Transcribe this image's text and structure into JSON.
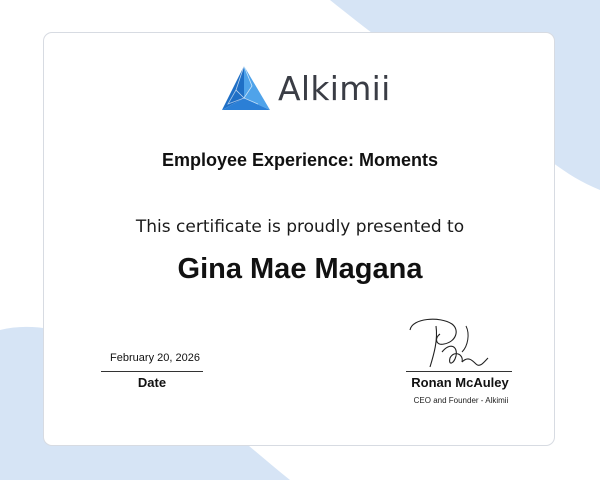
{
  "certificate": {
    "logo_text": "Alkimii",
    "course_title": "Employee Experience: Moments",
    "presented_text": "This certificate is proudly presented to",
    "recipient_name": "Gina Mae Magana",
    "date_value": "February 20, 2026",
    "date_label": "Date",
    "signer_name": "Ronan McAuley",
    "signer_title": "CEO and Founder - Alkimii"
  },
  "colors": {
    "background_wave": "#d6e4f5",
    "logo_blue_dark": "#1f6fc6",
    "logo_blue_light": "#4fa3ea",
    "card_border": "#d7dbe2"
  },
  "icons": {
    "logo_mark": "alkimii-triangle-logo-icon",
    "signature": "handwritten-signature"
  }
}
